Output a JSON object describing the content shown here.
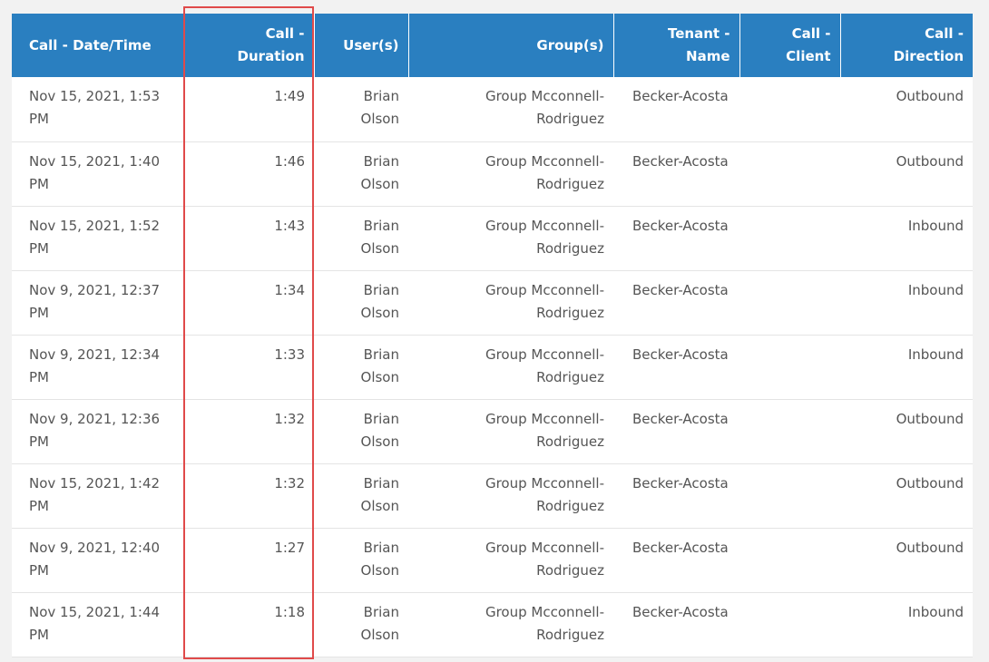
{
  "table": {
    "headers": [
      {
        "line1": "Call - Date/Time",
        "line2": ""
      },
      {
        "line1": "Call -",
        "line2": "Duration"
      },
      {
        "line1": "User(s)",
        "line2": ""
      },
      {
        "line1": "Group(s)",
        "line2": ""
      },
      {
        "line1": "Tenant -",
        "line2": "Name"
      },
      {
        "line1": "Call -",
        "line2": "Client"
      },
      {
        "line1": "Call -",
        "line2": "Direction"
      }
    ],
    "rows": [
      {
        "datetime": [
          "Nov 15, 2021, 1:53",
          "PM"
        ],
        "duration": "1:49",
        "user": [
          "Brian",
          "Olson"
        ],
        "group": [
          "Group Mcconnell-",
          "Rodriguez"
        ],
        "tenant": "Becker-Acosta",
        "client": "",
        "direction": "Outbound"
      },
      {
        "datetime": [
          "Nov 15, 2021, 1:40",
          "PM"
        ],
        "duration": "1:46",
        "user": [
          "Brian",
          "Olson"
        ],
        "group": [
          "Group Mcconnell-",
          "Rodriguez"
        ],
        "tenant": "Becker-Acosta",
        "client": "",
        "direction": "Outbound"
      },
      {
        "datetime": [
          "Nov 15, 2021, 1:52",
          "PM"
        ],
        "duration": "1:43",
        "user": [
          "Brian",
          "Olson"
        ],
        "group": [
          "Group Mcconnell-",
          "Rodriguez"
        ],
        "tenant": "Becker-Acosta",
        "client": "",
        "direction": "Inbound"
      },
      {
        "datetime": [
          "Nov 9, 2021, 12:37",
          "PM"
        ],
        "duration": "1:34",
        "user": [
          "Brian",
          "Olson"
        ],
        "group": [
          "Group Mcconnell-",
          "Rodriguez"
        ],
        "tenant": "Becker-Acosta",
        "client": "",
        "direction": "Inbound"
      },
      {
        "datetime": [
          "Nov 9, 2021, 12:34",
          "PM"
        ],
        "duration": "1:33",
        "user": [
          "Brian",
          "Olson"
        ],
        "group": [
          "Group Mcconnell-",
          "Rodriguez"
        ],
        "tenant": "Becker-Acosta",
        "client": "",
        "direction": "Inbound"
      },
      {
        "datetime": [
          "Nov 9, 2021, 12:36",
          "PM"
        ],
        "duration": "1:32",
        "user": [
          "Brian",
          "Olson"
        ],
        "group": [
          "Group Mcconnell-",
          "Rodriguez"
        ],
        "tenant": "Becker-Acosta",
        "client": "",
        "direction": "Outbound"
      },
      {
        "datetime": [
          "Nov 15, 2021, 1:42",
          "PM"
        ],
        "duration": "1:32",
        "user": [
          "Brian",
          "Olson"
        ],
        "group": [
          "Group Mcconnell-",
          "Rodriguez"
        ],
        "tenant": "Becker-Acosta",
        "client": "",
        "direction": "Outbound"
      },
      {
        "datetime": [
          "Nov 9, 2021, 12:40",
          "PM"
        ],
        "duration": "1:27",
        "user": [
          "Brian",
          "Olson"
        ],
        "group": [
          "Group Mcconnell-",
          "Rodriguez"
        ],
        "tenant": "Becker-Acosta",
        "client": "",
        "direction": "Outbound"
      },
      {
        "datetime": [
          "Nov 15, 2021, 1:44",
          "PM"
        ],
        "duration": "1:18",
        "user": [
          "Brian",
          "Olson"
        ],
        "group": [
          "Group Mcconnell-",
          "Rodriguez"
        ],
        "tenant": "Becker-Acosta",
        "client": "",
        "direction": "Inbound"
      }
    ]
  },
  "colors": {
    "header_bg": "#2a7fc0",
    "header_text": "#ffffff",
    "cell_text": "#555555",
    "highlight_border": "#e04a4a"
  }
}
